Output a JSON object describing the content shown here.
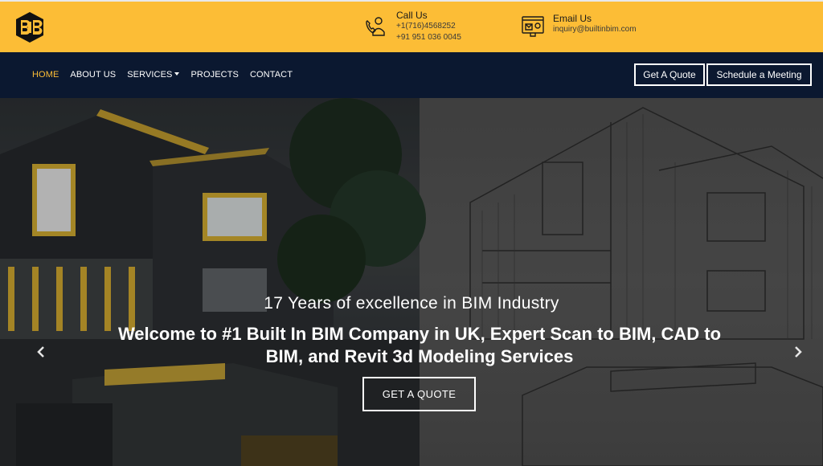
{
  "brand": {
    "logo_icon": "bib-hexagon-logo",
    "accent": "#fcbd36",
    "nav_bg": "#0b1830"
  },
  "contact": {
    "call": {
      "title": "Call Us",
      "phone1": "+1(716)4568252",
      "phone2": "+91 951 036 0045",
      "icon": "call-support-icon"
    },
    "email": {
      "title": "Email Us",
      "address": "inquiry@builtinbim.com",
      "icon": "email-support-icon"
    }
  },
  "nav": {
    "items": [
      {
        "label": "HOME",
        "active": true
      },
      {
        "label": "ABOUT US"
      },
      {
        "label": "SERVICES"
      },
      {
        "label": "PROJECTS"
      },
      {
        "label": "CONTACT"
      }
    ],
    "quote_button": "Get A Quote",
    "meeting_button": "Schedule a Meeting"
  },
  "hero": {
    "subtitle": "17 Years of excellence in BIM Industry",
    "title": "Welcome to #1 Built In BIM Company in UK, Expert Scan to BIM, CAD to BIM, and Revit 3d Modeling Services",
    "cta": "GET A QUOTE",
    "prev_icon": "chevron-left-icon",
    "next_icon": "chevron-right-icon"
  }
}
